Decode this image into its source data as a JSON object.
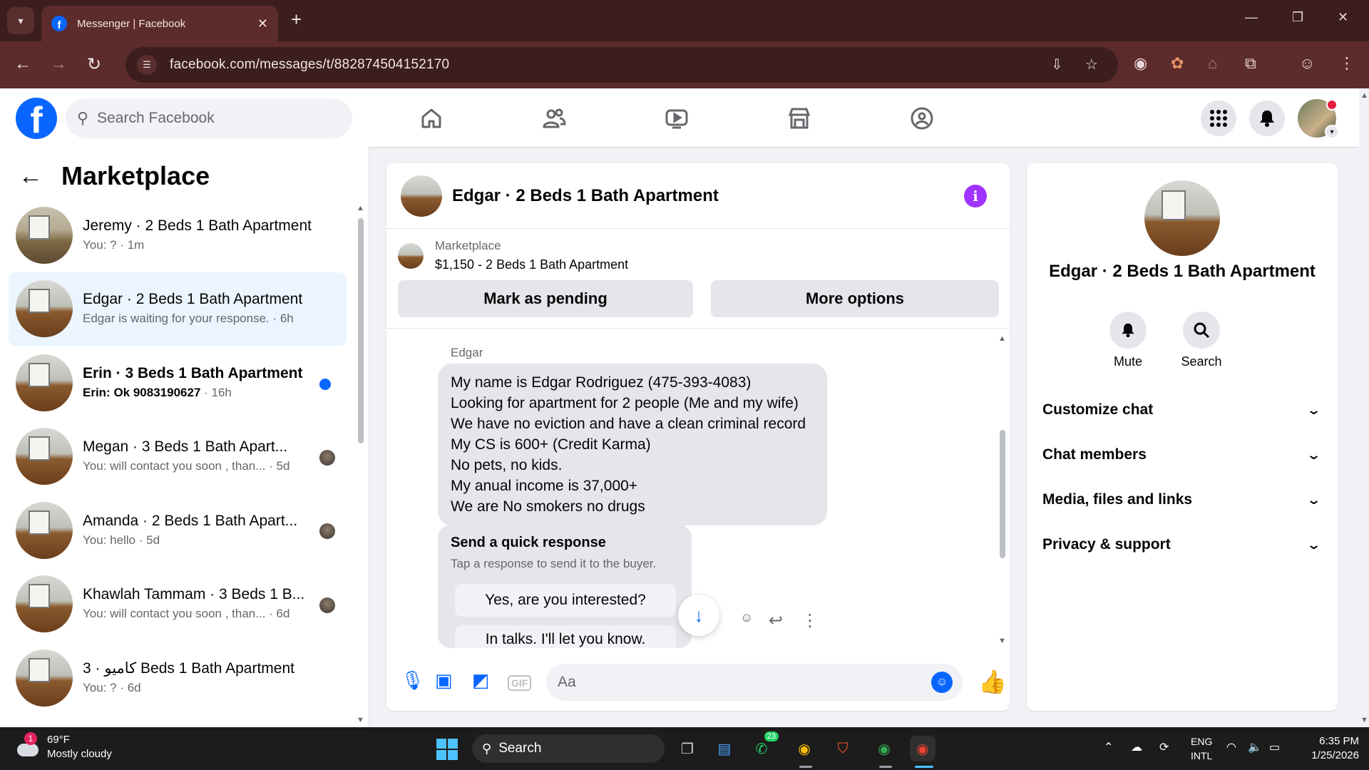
{
  "browser": {
    "tab_title": "Messenger | Facebook",
    "url": "facebook.com/messages/t/882874504152170"
  },
  "fbnav": {
    "logo_letter": "f",
    "search_placeholder": "Search Facebook"
  },
  "sidebar": {
    "title": "Marketplace",
    "chats": [
      {
        "name": "Jeremy · 2 Beds 1 Bath Apartment",
        "preview": "You: ? · 1m",
        "active": false,
        "unread": false
      },
      {
        "name": "Edgar · 2 Beds 1 Bath Apartment",
        "preview": "Edgar is waiting for your response. · 6h",
        "active": true,
        "unread": false
      },
      {
        "name": "Erin · 3 Beds 1 Bath Apartment",
        "preview": "Erin: Ok 9083190627",
        "time": " · 16h",
        "active": false,
        "unread": true
      },
      {
        "name": "Megan · 3 Beds 1 Bath Apart...",
        "preview": "You: will contact you soon , than... · 5d",
        "active": false,
        "unread": false
      },
      {
        "name": "Amanda · 2 Beds 1 Bath Apart...",
        "preview": "You: hello · 5d",
        "active": false,
        "unread": false
      },
      {
        "name": "Khawlah Tammam · 3 Beds 1 B...",
        "preview": "You: will contact you soon , than... · 6d",
        "active": false,
        "unread": false
      },
      {
        "name": "كاميو · 3 Beds 1 Bath Apartment",
        "preview": "You: ? · 6d",
        "active": false,
        "unread": false
      }
    ]
  },
  "conversation": {
    "title": "Edgar · 2 Beds 1 Bath Apartment",
    "marketplace_label": "Marketplace",
    "listing": "$1,150 - 2 Beds 1 Bath Apartment",
    "mark_pending": "Mark as pending",
    "more_options": "More options",
    "sender": "Edgar",
    "message_lines": [
      "My name is Edgar Rodriguez (475-393-4083)",
      "Looking for apartment for 2 people (Me and my wife)",
      "We have no eviction and have a clean criminal record",
      "My CS is 600+ (Credit Karma)",
      "No pets, no kids.",
      "My anual income is 37,000+",
      "We are No smokers no drugs"
    ],
    "quick_title": "Send a quick response",
    "quick_sub": "Tap a response to send it to the buyer.",
    "quick_options": [
      "Yes, are you interested?",
      "In talks. I'll let you know."
    ],
    "composer_placeholder": "Aa"
  },
  "info_panel": {
    "name": "Edgar · 2 Beds 1 Bath Apartment",
    "mute_label": "Mute",
    "search_label": "Search",
    "rows": [
      "Customize chat",
      "Chat members",
      "Media, files and links",
      "Privacy & support"
    ]
  },
  "taskbar": {
    "weather_badge": "1",
    "temperature": "69°F",
    "condition": "Mostly cloudy",
    "search_label": "Search",
    "whatsapp_badge": "23",
    "lang_1": "ENG",
    "lang_2": "INTL",
    "time": "6:35 PM",
    "date": "1/25/2026"
  },
  "colors": {
    "facebook_blue": "#0866ff",
    "active_chat_bg": "#ebf5ff",
    "info_purple": "#a033ff",
    "browser_frame": "#5c2b2b"
  }
}
